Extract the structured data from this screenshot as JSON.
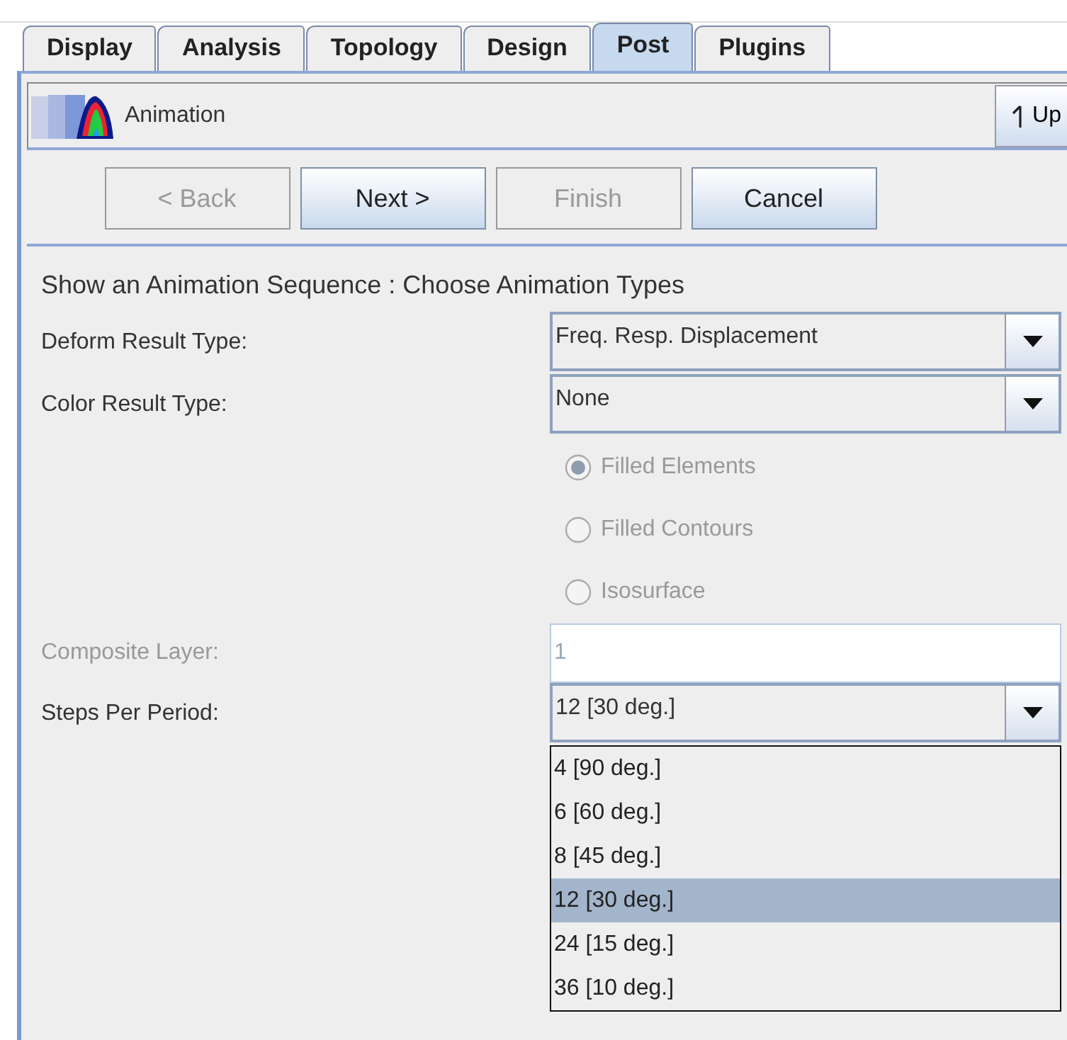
{
  "tabs": [
    {
      "label": "Display",
      "selected": false
    },
    {
      "label": "Analysis",
      "selected": false
    },
    {
      "label": "Topology",
      "selected": false
    },
    {
      "label": "Design",
      "selected": false
    },
    {
      "label": "Post",
      "selected": true
    },
    {
      "label": "Plugins",
      "selected": false
    }
  ],
  "panel": {
    "title": "Animation",
    "up_button": "Up"
  },
  "buttons": [
    {
      "label": "< Back",
      "disabled": true
    },
    {
      "label": "Next >",
      "disabled": false
    },
    {
      "label": "Finish",
      "disabled": true
    },
    {
      "label": "Cancel",
      "disabled": false
    }
  ],
  "heading": "Show an Animation Sequence : Choose Animation Types",
  "fields": [
    {
      "kind": "combo",
      "label": "Deform Result Type:",
      "value": "Freq. Resp. Displacement",
      "disabled": false
    },
    {
      "kind": "combo",
      "label": "Color Result Type:",
      "value": "None",
      "disabled": false
    },
    {
      "kind": "radios",
      "disabled": true,
      "options": [
        {
          "label": "Filled Elements",
          "selected": true
        },
        {
          "label": "Filled Contours",
          "selected": false
        },
        {
          "label": "Isosurface",
          "selected": false
        }
      ]
    },
    {
      "kind": "text",
      "label": "Composite Layer:",
      "value": "1",
      "disabled": true
    },
    {
      "kind": "combo",
      "label": "Steps Per Period:",
      "value": "12 [30 deg.]",
      "disabled": false,
      "expanded": true,
      "options": [
        {
          "label": "4 [90 deg.]",
          "selected": false
        },
        {
          "label": "6 [60 deg.]",
          "selected": false
        },
        {
          "label": "8 [45 deg.]",
          "selected": false
        },
        {
          "label": "12 [30 deg.]",
          "selected": true
        },
        {
          "label": "24 [15 deg.]",
          "selected": false
        },
        {
          "label": "36 [10 deg.]",
          "selected": false
        }
      ]
    }
  ]
}
